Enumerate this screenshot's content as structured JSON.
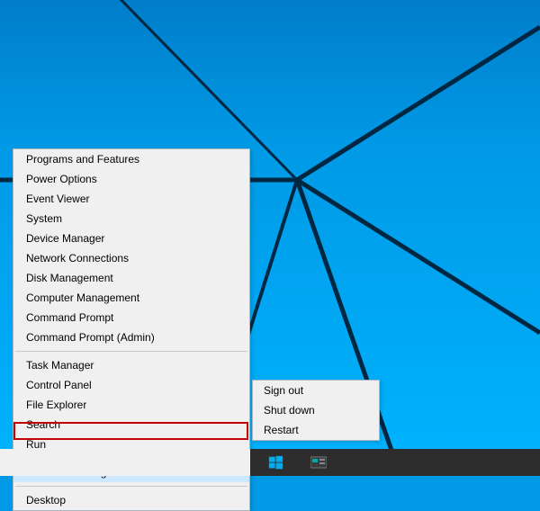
{
  "menu": {
    "section1": [
      "Programs and Features",
      "Power Options",
      "Event Viewer",
      "System",
      "Device Manager",
      "Network Connections",
      "Disk Management",
      "Computer Management",
      "Command Prompt",
      "Command Prompt (Admin)"
    ],
    "section2": [
      "Task Manager",
      "Control Panel",
      "File Explorer",
      "Search",
      "Run"
    ],
    "section3_submenu_item": "Shut down or sign out",
    "section4": [
      "Desktop"
    ]
  },
  "submenu": {
    "items": [
      "Sign out",
      "Shut down",
      "Restart"
    ]
  },
  "colors": {
    "highlight": "#c40000",
    "menu_bg": "#f0f0f0",
    "desktop_top": "#007dca",
    "desktop_bottom": "#00b4ff"
  }
}
